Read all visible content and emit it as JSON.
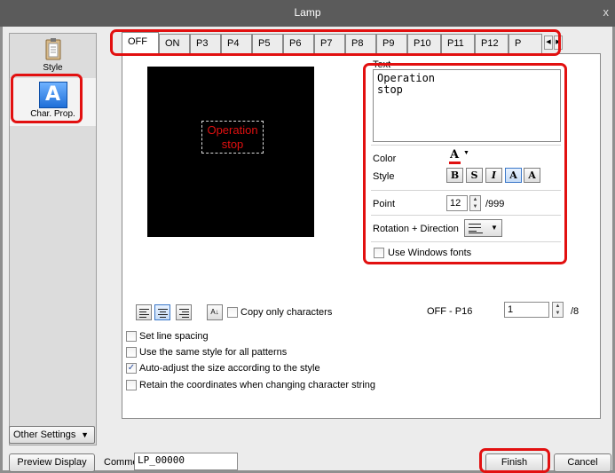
{
  "window": {
    "title": "Lamp",
    "close_glyph": "x"
  },
  "sidebar": {
    "items": [
      {
        "label": "Style",
        "icon": "clipboard-icon"
      },
      {
        "label": "Char. Prop.",
        "icon": "char-a-icon",
        "glyph": "A"
      }
    ],
    "other_settings": "Other Settings"
  },
  "tabs": {
    "items": [
      "OFF",
      "ON",
      "P3",
      "P4",
      "P5",
      "P6",
      "P7",
      "P8",
      "P9",
      "P10",
      "P11",
      "P12",
      "P"
    ],
    "active": "OFF"
  },
  "preview": {
    "line1": "Operation",
    "line2": "stop",
    "text_color": "#e01010"
  },
  "text_section": {
    "label": "Text",
    "value": "Operation\nstop",
    "color_label": "Color",
    "color_glyph": "A",
    "style_label": "Style",
    "style_buttons": [
      "B",
      "S",
      "I",
      "A",
      "A"
    ],
    "point_label": "Point",
    "point_value": "12",
    "point_max": "/999",
    "rotation_label": "Rotation + Direction",
    "use_windows_fonts": "Use Windows fonts"
  },
  "options": {
    "copy_only_characters": "Copy only characters",
    "range_label": "OFF - P16",
    "range_value": "1",
    "range_max": "/8",
    "checkboxes": [
      {
        "label": "Set line spacing",
        "checked": false
      },
      {
        "label": "Use the same style for all patterns",
        "checked": false
      },
      {
        "label": "Auto-adjust the size according to the style",
        "checked": true
      },
      {
        "label": "Retain the coordinates when changing character string",
        "checked": false
      }
    ]
  },
  "footer": {
    "preview_display": "Preview Display",
    "comment_label": "Comme",
    "comment_value": "LP_00000",
    "finish": "Finish",
    "cancel": "Cancel"
  },
  "colors": {
    "highlight": "#e21010",
    "titlebar": "#5b5b5b"
  }
}
